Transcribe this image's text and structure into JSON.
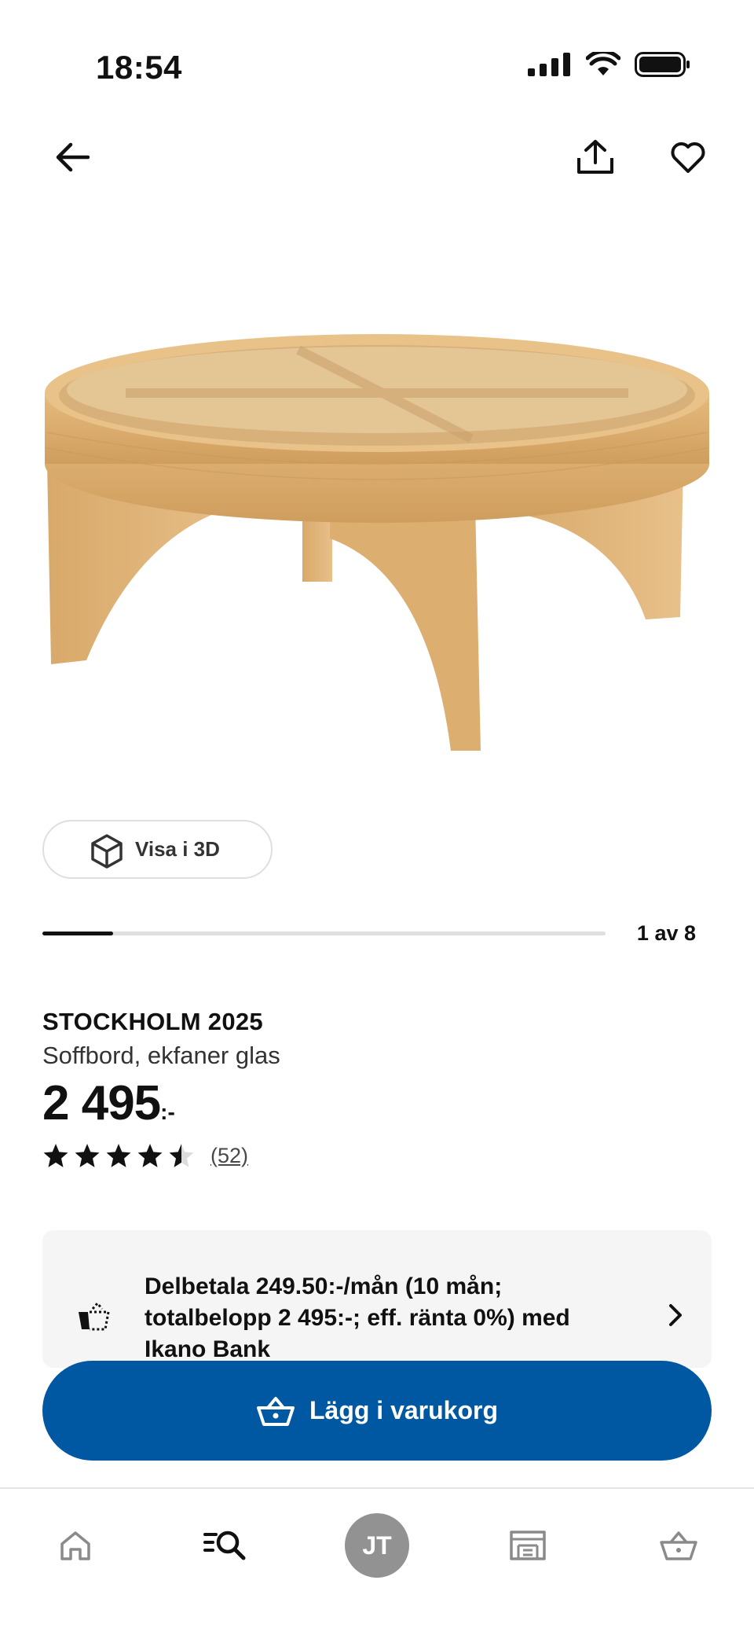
{
  "status_bar": {
    "time": "18:54"
  },
  "product": {
    "name": "STOCKHOLM 2025",
    "description": "Soffbord, ekfaner glas",
    "price": "2 495",
    "price_suffix": ":-",
    "rating": 4.5,
    "rating_max": 5,
    "review_count": "(52)"
  },
  "gallery": {
    "view_3d_label": "Visa i 3D",
    "counter": "1 av 8",
    "progress_fraction": 0.125
  },
  "financing": {
    "text": "Delbetala 249.50:-/mån (10 mån; totalbelopp 2 495:-; eff. ränta 0%) med Ikano Bank"
  },
  "cart_button": {
    "label": "Lägg i varukorg"
  },
  "tab_bar": {
    "avatar_initials": "JT",
    "tabs": [
      "home-icon",
      "search-icon",
      "avatar",
      "store-icon",
      "cart-icon"
    ]
  },
  "colors": {
    "primary": "#0058a3",
    "wood": "#d9ac6f",
    "avatar": "#929292"
  }
}
